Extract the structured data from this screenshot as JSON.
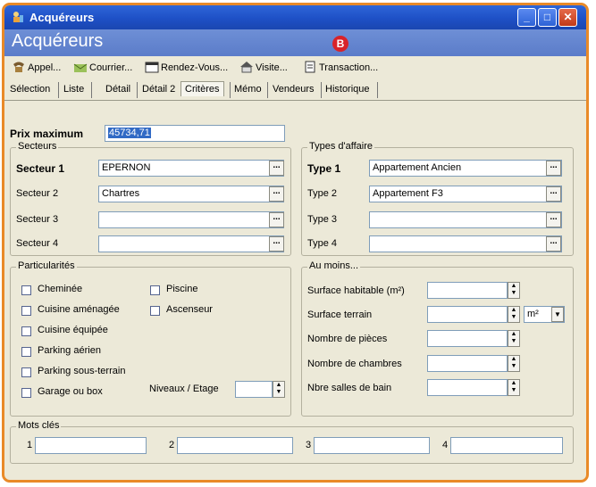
{
  "window": {
    "title": "Acquéreurs",
    "header": "Acquéreurs",
    "badge": "B"
  },
  "toolbar": {
    "appel": "Appel...",
    "courrier": "Courrier...",
    "rendezvous": "Rendez-Vous...",
    "visite": "Visite...",
    "transaction": "Transaction..."
  },
  "tabs": [
    "Sélection",
    "Liste",
    "Détail",
    "Détail 2",
    "Critères",
    "Mémo",
    "Vendeurs",
    "Historique"
  ],
  "prix": {
    "label": "Prix maximum",
    "value": "45734,71"
  },
  "secteurs": {
    "title": "Secteurs",
    "rows": [
      {
        "label": "Secteur 1",
        "value": "EPERNON"
      },
      {
        "label": "Secteur 2",
        "value": "Chartres"
      },
      {
        "label": "Secteur 3",
        "value": ""
      },
      {
        "label": "Secteur 4",
        "value": ""
      }
    ]
  },
  "types": {
    "title": "Types d'affaire",
    "rows": [
      {
        "label": "Type 1",
        "value": "Appartement Ancien"
      },
      {
        "label": "Type 2",
        "value": "Appartement F3"
      },
      {
        "label": "Type 3",
        "value": ""
      },
      {
        "label": "Type 4",
        "value": ""
      }
    ]
  },
  "particularites": {
    "title": "Particularités",
    "cheminee": "Cheminée",
    "piscine": "Piscine",
    "cuisine_amenagee": "Cuisine aménagée",
    "ascenseur": "Ascenseur",
    "cuisine_equipee": "Cuisine équipée",
    "parking_aerien": "Parking aérien",
    "parking_sous_terrain": "Parking sous-terrain",
    "garage": "Garage ou box",
    "niveaux": "Niveaux / Etage"
  },
  "au_moins": {
    "title": "Au moins...",
    "surface_habitable": "Surface habitable (m²)",
    "surface_terrain": "Surface terrain",
    "unit": "m²",
    "nombre_pieces": "Nombre de pièces",
    "nombre_chambres": "Nombre de chambres",
    "salles_bain": "Nbre salles de bain"
  },
  "mots_cles": {
    "title": "Mots clés",
    "n1": "1",
    "n2": "2",
    "n3": "3",
    "n4": "4"
  },
  "dots": "...",
  "colors": {
    "frame": "#e98a28",
    "titlebar": "#1e50c6",
    "header": "#6e8fd6",
    "badge": "#d8232a"
  }
}
